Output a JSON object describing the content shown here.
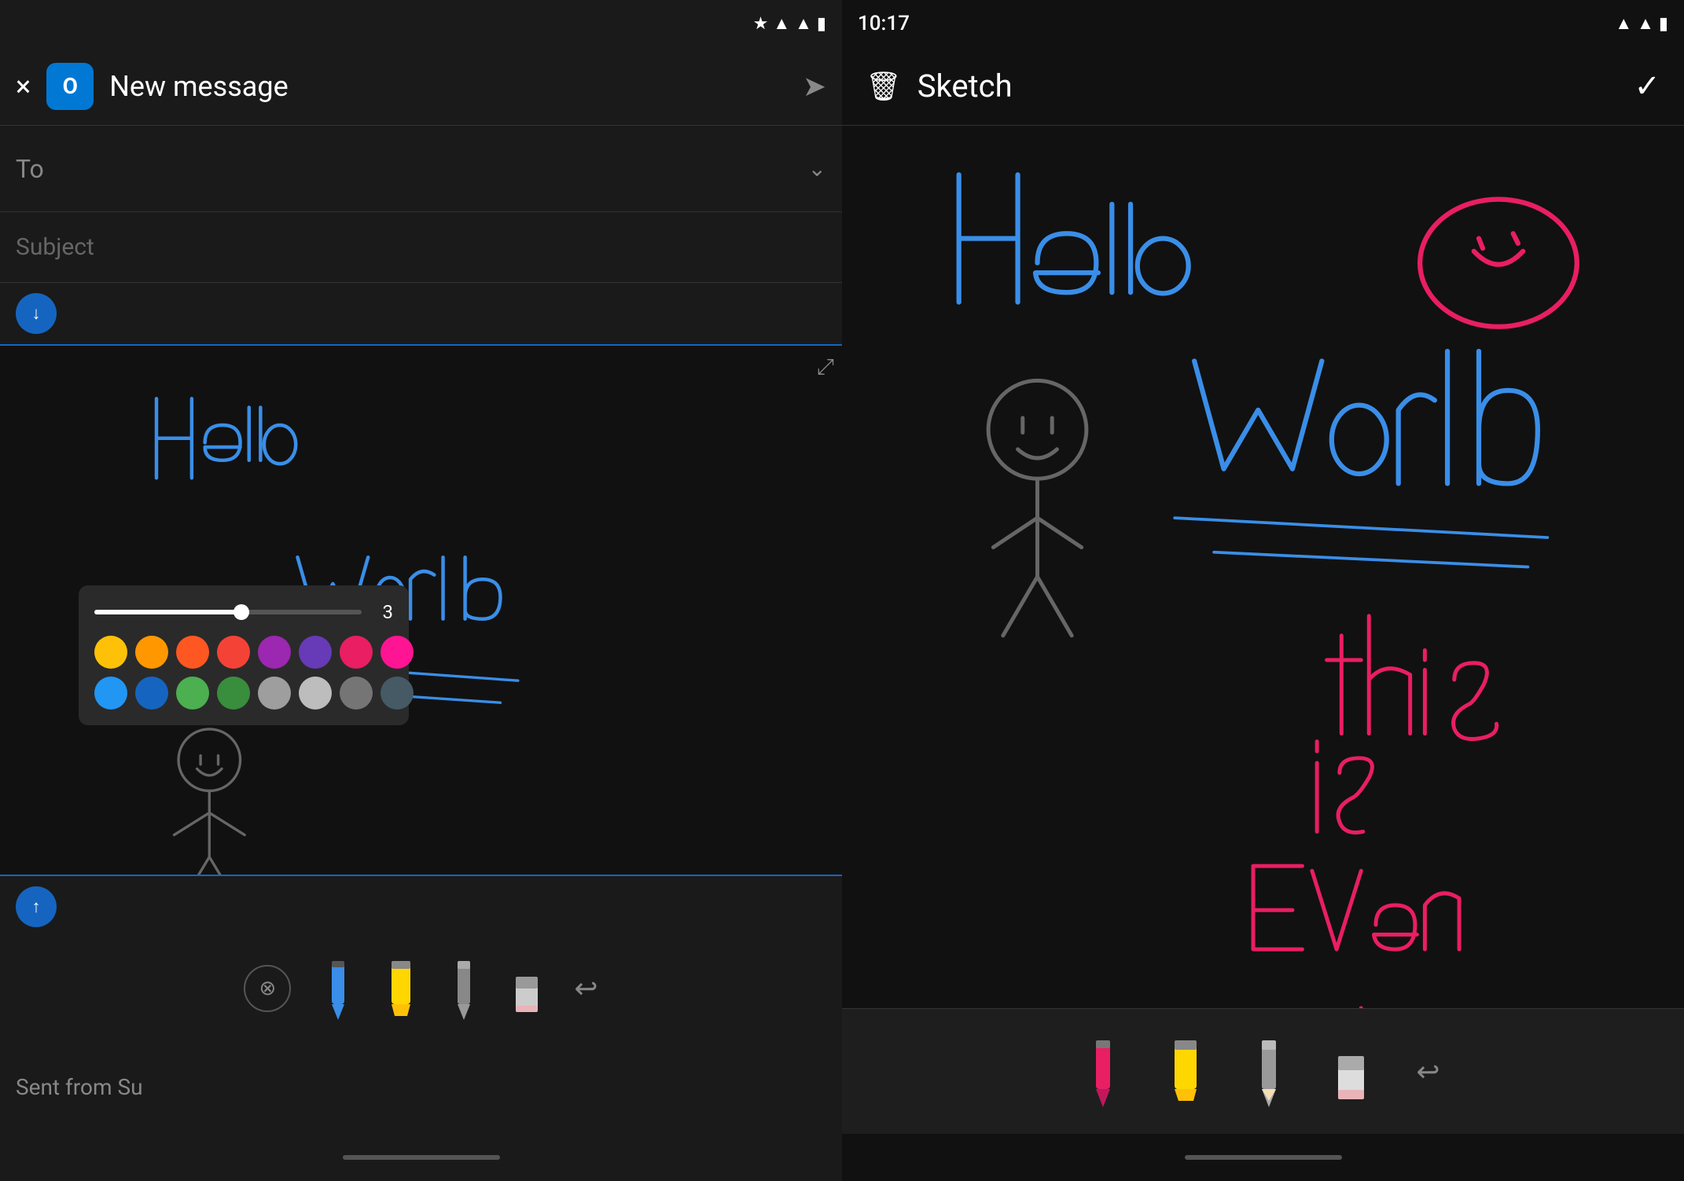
{
  "left_panel": {
    "status_bar": {
      "icons": "bluetooth signal wifi battery"
    },
    "header": {
      "close_label": "×",
      "app_icon": "O",
      "title": "New message",
      "send_icon": "➤"
    },
    "to_row": {
      "label": "To",
      "chevron": "⌄"
    },
    "subject_row": {
      "label": "Subject"
    },
    "sketch_area": {
      "expand_icon": "⤢"
    },
    "color_picker": {
      "slider_value": "3",
      "colors_row1": [
        "#FFC107",
        "#FF9800",
        "#FF5722",
        "#F44336",
        "#9C27B0",
        "#673AB7",
        "#E91E63",
        "#FF1493"
      ],
      "colors_row2": [
        "#2196F3",
        "#1565C0",
        "#4CAF50",
        "#388E3C",
        "#9E9E9E",
        "#BDBDBD",
        "#757575",
        "#455A64"
      ]
    },
    "drawing_tools": {
      "clear_label": "⊗",
      "pen_label": "pen",
      "highlighter_label": "highlighter",
      "eraser_label": "eraser",
      "eraser2_label": "eraser2",
      "undo_label": "↩"
    },
    "sent_from": {
      "text": "Sent from Su"
    },
    "nav_bar": {}
  },
  "right_panel": {
    "status_bar": {
      "time": "10:17",
      "icons": "signal wifi battery"
    },
    "header": {
      "trash_icon": "🗑",
      "title": "Sketch",
      "check_icon": "✓"
    },
    "drawing_tools": {
      "pen_label": "pen",
      "highlighter_label": "highlighter",
      "pencil_label": "pencil",
      "eraser_label": "eraser",
      "undo_label": "↩"
    },
    "sketch": {
      "hello_world_text": "Hello World",
      "this_is_text": "this is even more room"
    }
  }
}
